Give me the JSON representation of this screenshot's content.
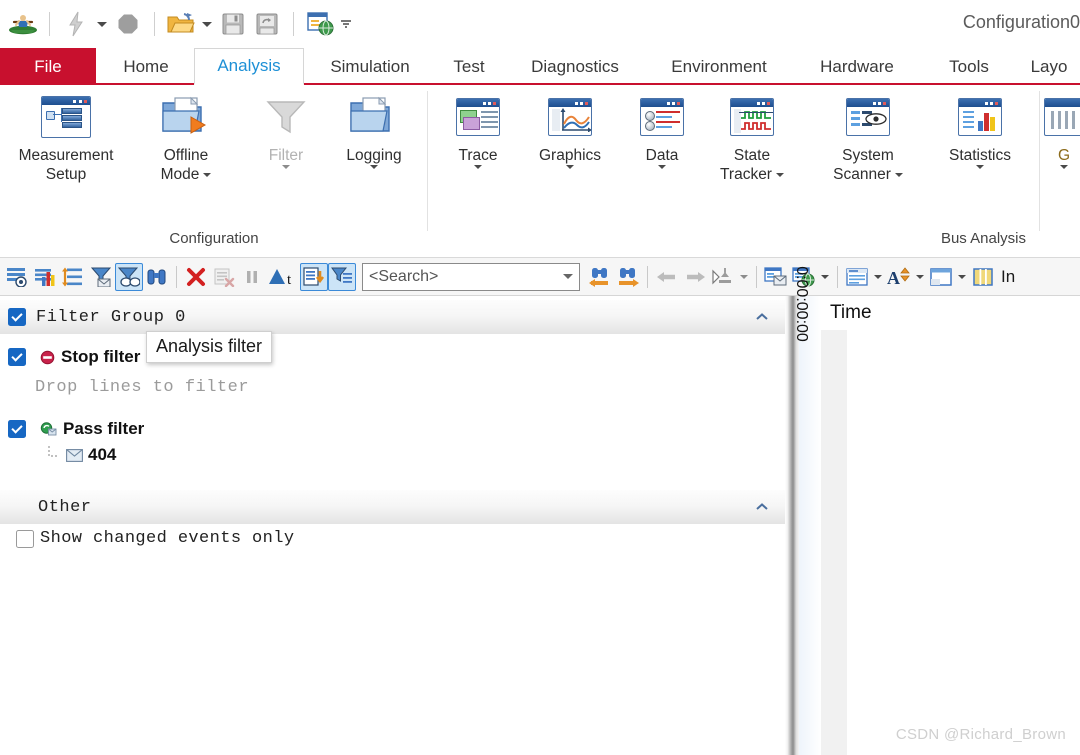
{
  "window": {
    "title": "Configuration0"
  },
  "quick_access": {
    "items": [
      {
        "name": "app-logo-icon",
        "label": "CANoe"
      },
      {
        "name": "flash-icon",
        "label": "Flash"
      },
      {
        "name": "flash-dropdown",
        "label": "Flash options"
      },
      {
        "name": "stop-icon",
        "label": "Stop"
      },
      {
        "name": "open-folder-icon",
        "label": "Open"
      },
      {
        "name": "open-dropdown",
        "label": "Open options"
      },
      {
        "name": "save-icon",
        "label": "Save"
      },
      {
        "name": "save-as-icon",
        "label": "Save As"
      },
      {
        "name": "publish-icon",
        "label": "Publish"
      },
      {
        "name": "customize-dropdown",
        "label": "Customize Quick Access Toolbar"
      }
    ]
  },
  "ribbon": {
    "tabs": [
      {
        "id": "file",
        "label": "File",
        "state": "file"
      },
      {
        "id": "home",
        "label": "Home",
        "state": "normal"
      },
      {
        "id": "analysis",
        "label": "Analysis",
        "state": "active"
      },
      {
        "id": "simulation",
        "label": "Simulation",
        "state": "normal"
      },
      {
        "id": "test",
        "label": "Test",
        "state": "normal"
      },
      {
        "id": "diagnostics",
        "label": "Diagnostics",
        "state": "normal"
      },
      {
        "id": "environment",
        "label": "Environment",
        "state": "normal"
      },
      {
        "id": "hardware",
        "label": "Hardware",
        "state": "normal"
      },
      {
        "id": "tools",
        "label": "Tools",
        "state": "normal"
      },
      {
        "id": "layout",
        "label": "Layo",
        "state": "normal"
      }
    ],
    "groups": [
      {
        "id": "configuration",
        "title": "Configuration",
        "items": [
          {
            "id": "measurement-setup",
            "line1": "Measurement",
            "line2": "Setup",
            "icon": "measurement-setup-icon",
            "dropdown": false,
            "disabled": false
          },
          {
            "id": "offline-mode",
            "line1": "Offline",
            "line2": "Mode",
            "icon": "offline-mode-icon",
            "dropdown": true,
            "disabled": false
          },
          {
            "id": "filter",
            "line1": "Filter",
            "line2": "",
            "icon": "funnel-icon",
            "dropdown": true,
            "disabled": true
          },
          {
            "id": "logging",
            "line1": "Logging",
            "line2": "",
            "icon": "logging-icon",
            "dropdown": true,
            "disabled": false
          }
        ]
      },
      {
        "id": "bus-analysis",
        "title": "Bus Analysis",
        "items": [
          {
            "id": "trace",
            "line1": "Trace",
            "line2": "",
            "icon": "trace-icon",
            "dropdown": true,
            "disabled": false
          },
          {
            "id": "graphics",
            "line1": "Graphics",
            "line2": "",
            "icon": "graphics-icon",
            "dropdown": true,
            "disabled": false
          },
          {
            "id": "data",
            "line1": "Data",
            "line2": "",
            "icon": "data-icon",
            "dropdown": true,
            "disabled": false
          },
          {
            "id": "state-tracker",
            "line1": "State",
            "line2": "Tracker",
            "icon": "state-tracker-icon",
            "dropdown": true,
            "disabled": false
          },
          {
            "id": "system-scanner",
            "line1": "System",
            "line2": "Scanner",
            "icon": "system-scanner-icon",
            "dropdown": true,
            "disabled": false
          },
          {
            "id": "statistics",
            "line1": "Statistics",
            "line2": "",
            "icon": "statistics-icon",
            "dropdown": true,
            "disabled": false
          }
        ]
      },
      {
        "id": "truncated",
        "title": "",
        "items": [
          {
            "id": "g-truncated",
            "line1": "G",
            "line2": "",
            "icon": "gateway-icon",
            "dropdown": true,
            "disabled": false
          }
        ]
      }
    ]
  },
  "toolbar": {
    "left_buttons": [
      {
        "id": "config-trace",
        "name": "configure-trace-icon",
        "selected": false,
        "disabled": false
      },
      {
        "id": "statistics-view",
        "name": "statistics-view-icon",
        "selected": false,
        "disabled": false
      },
      {
        "id": "expand-rows",
        "name": "expand-rows-icon",
        "selected": false,
        "disabled": false
      },
      {
        "id": "message-filter",
        "name": "message-filter-icon",
        "selected": false,
        "disabled": false
      },
      {
        "id": "analysis-filter",
        "name": "analysis-filter-icon",
        "selected": true,
        "disabled": false
      },
      {
        "id": "find",
        "name": "binoculars-icon",
        "selected": false,
        "disabled": false
      },
      {
        "id": "clear",
        "name": "clear-red-x-icon",
        "selected": false,
        "disabled": false
      },
      {
        "id": "clear-list",
        "name": "clear-list-icon",
        "selected": false,
        "disabled": true
      },
      {
        "id": "pause",
        "name": "pause-icon",
        "selected": false,
        "disabled": true
      },
      {
        "id": "abs-time",
        "name": "absolute-time-icon",
        "selected": false,
        "disabled": false
      },
      {
        "id": "logging-marker",
        "name": "logging-marker-icon",
        "selected": true,
        "disabled": false
      },
      {
        "id": "filter-panel-toggle",
        "name": "filter-panel-toggle-icon",
        "selected": true,
        "disabled": false
      }
    ],
    "search": {
      "placeholder": "<Search>",
      "value": ""
    },
    "right_buttons": [
      {
        "id": "find-prev",
        "name": "find-previous-icon"
      },
      {
        "id": "find-next",
        "name": "find-next-icon"
      },
      {
        "id": "nav-back",
        "name": "arrow-left-icon"
      },
      {
        "id": "nav-forward",
        "name": "arrow-right-icon"
      },
      {
        "id": "marker",
        "name": "marker-icon"
      },
      {
        "id": "marker-drop",
        "name": "marker-dropdown-icon"
      },
      {
        "id": "window-split",
        "name": "window-split-icon"
      },
      {
        "id": "window-globe",
        "name": "window-globe-icon"
      },
      {
        "id": "window-globe-drop",
        "name": "window-globe-dropdown-icon"
      },
      {
        "id": "rows-layout",
        "name": "rows-layout-icon"
      },
      {
        "id": "rows-layout-drop",
        "name": "rows-layout-dropdown-icon"
      },
      {
        "id": "font-size",
        "name": "font-size-icon"
      },
      {
        "id": "font-size-drop",
        "name": "font-size-dropdown-icon"
      },
      {
        "id": "panel-layout",
        "name": "panel-layout-icon"
      },
      {
        "id": "panel-layout-drop",
        "name": "panel-layout-dropdown-icon"
      },
      {
        "id": "columns",
        "name": "columns-icon"
      }
    ],
    "trailing_label": "In"
  },
  "filter_panel": {
    "groups": [
      {
        "id": "filter-group-0",
        "label": "Filter Group 0",
        "checked": true,
        "collapsible": true
      },
      {
        "id": "other",
        "label": "Other",
        "checked": false,
        "collapsible": true
      }
    ],
    "stop_filter": {
      "label": "Stop filter",
      "checked": true,
      "icon": "stop-filter-icon"
    },
    "drop_hint": "Drop lines to filter",
    "pass_filter": {
      "label": "Pass filter",
      "checked": true,
      "icon": "pass-filter-icon"
    },
    "pass_filter_child": {
      "label": "404",
      "icon": "message-envelope-icon"
    },
    "show_changed_events": {
      "label": "Show changed events only",
      "checked": false
    }
  },
  "tooltip": {
    "text": "Analysis filter"
  },
  "right_panel": {
    "column_header": "Time",
    "vertical_time": "0:00:00:00"
  },
  "watermark": "CSDN @Richard_Brown",
  "colors": {
    "accent_red": "#c8102e",
    "active_tab_text": "#1e90d6",
    "checkbox_blue": "#1667c3",
    "selection_blue": "#3b8ad8",
    "selection_fill": "#cce4f7"
  }
}
